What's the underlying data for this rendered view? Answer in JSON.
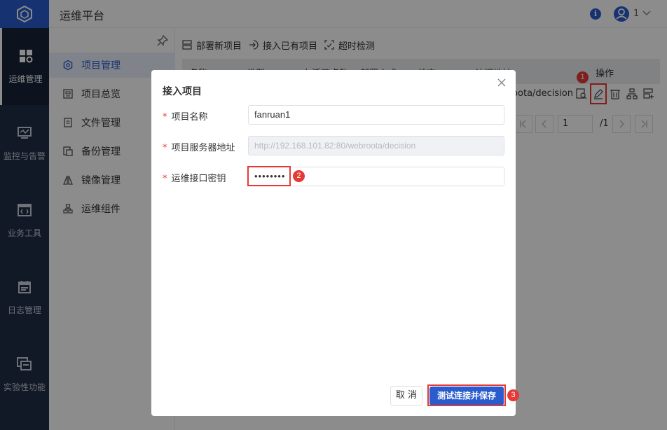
{
  "app": {
    "title": "运维平台",
    "user_name": "1"
  },
  "rail": {
    "items": [
      {
        "label": "运维管理",
        "icon": "grid-settings-icon"
      },
      {
        "label": "监控与告警",
        "icon": "monitor-chart-icon"
      },
      {
        "label": "业务工具",
        "icon": "code-window-icon"
      },
      {
        "label": "日志管理",
        "icon": "calendar-log-icon"
      },
      {
        "label": "实验性功能",
        "icon": "layers-icon"
      }
    ]
  },
  "submenu": {
    "items": [
      {
        "label": "项目管理",
        "icon": "gear-icon"
      },
      {
        "label": "项目总览",
        "icon": "overview-icon"
      },
      {
        "label": "文件管理",
        "icon": "file-icon"
      },
      {
        "label": "备份管理",
        "icon": "backup-icon"
      },
      {
        "label": "镜像管理",
        "icon": "mirror-icon"
      },
      {
        "label": "运维组件",
        "icon": "component-icon"
      }
    ]
  },
  "toolbar": {
    "deploy_label": "部署新项目",
    "connect_label": "接入已有项目",
    "timeout_label": "超时检测"
  },
  "table": {
    "columns": [
      "名称",
      "类型",
      "在活节点数",
      "部署方式",
      "状态",
      "访问地址",
      "操作"
    ],
    "row": {
      "url": "roota/decision"
    }
  },
  "pager": {
    "current": "1",
    "total": "/1"
  },
  "dialog": {
    "title": "接入项目",
    "fields": [
      {
        "label": "项目名称",
        "value": "fanruan1",
        "required": "*"
      },
      {
        "label": "项目服务器地址",
        "value": "http://192.168.101.82:80/webroota/decision",
        "required": "*"
      },
      {
        "label": "运维接口密钥",
        "value": "••••••••",
        "required": "*"
      }
    ],
    "cancel_label": "取 消",
    "save_label": "测试连接并保存"
  },
  "annotations": [
    "1",
    "2",
    "3"
  ],
  "colors": {
    "primary": "#2a5ccd",
    "rail": "#1f2d45",
    "highlight": "#e53935"
  }
}
